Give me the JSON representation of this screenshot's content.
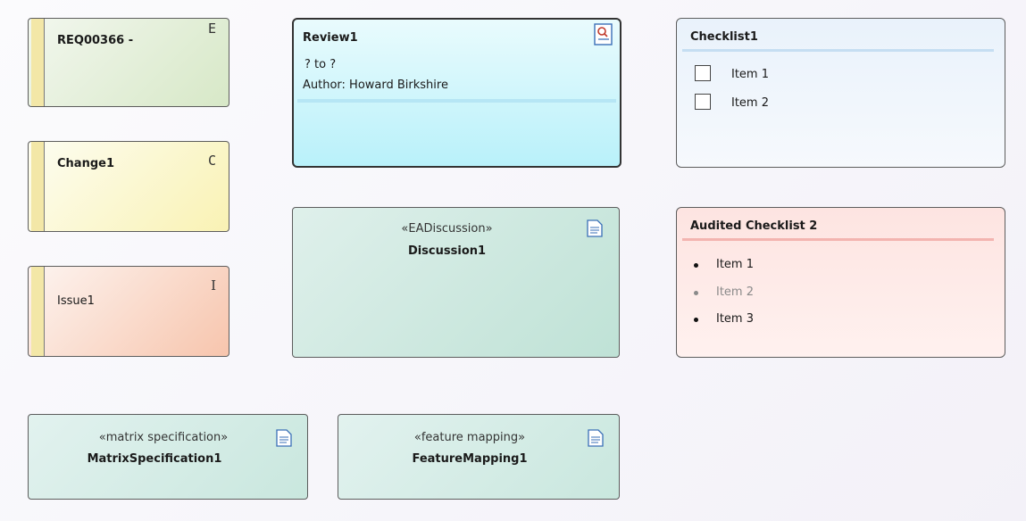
{
  "requirements": [
    {
      "name": "REQ00366 -",
      "icon": "E"
    },
    {
      "name": "Change1",
      "icon": "C"
    },
    {
      "name": "Issue1",
      "icon": "I"
    }
  ],
  "review": {
    "name": "Review1",
    "line1": "? to ?",
    "line2": "Author: Howard Birkshire",
    "icon": "review-icon"
  },
  "checklist": {
    "name": "Checklist1",
    "items": [
      "Item 1",
      "Item 2"
    ]
  },
  "audited_checklist": {
    "name": "Audited Checklist 2",
    "items": [
      "Item 1",
      "Item 2",
      "Item 3"
    ]
  },
  "discussion": {
    "stereotype": "«EADiscussion»",
    "name": "Discussion1"
  },
  "matrix": {
    "stereotype": "«matrix specification»",
    "name": "MatrixSpecification1"
  },
  "feature": {
    "stereotype": "«feature mapping»",
    "name": "FeatureMapping1"
  },
  "colors": {
    "requirement_fill": "#d7e8c7",
    "change_fill": "#f9f2b4",
    "issue_fill": "#f7c5ad",
    "review_fill": "#b9f1fa",
    "artifact_fill": "#bfe2d6",
    "audit_fill": "#fde4e1"
  }
}
